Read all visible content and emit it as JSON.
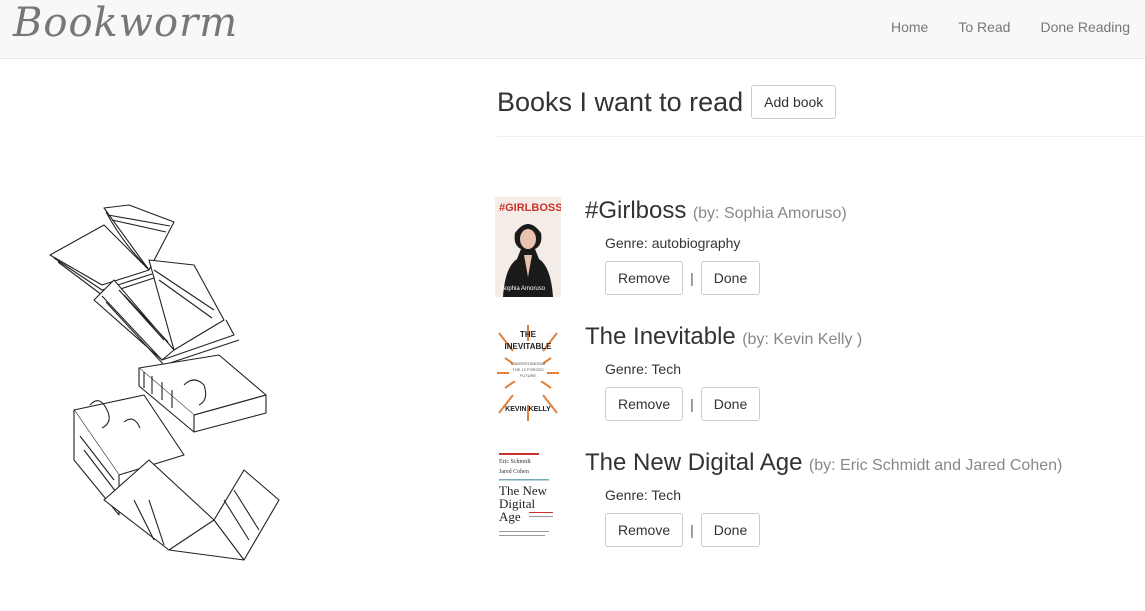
{
  "brand": "Bookworm",
  "nav": {
    "home": "Home",
    "to_read": "To Read",
    "done_reading": "Done Reading"
  },
  "page": {
    "title": "Books I want to read",
    "add_book_label": "Add book"
  },
  "books": [
    {
      "title": "#Girlboss",
      "author": "(by: Sophia Amoruso)",
      "genre": "Genre: autobiography",
      "remove_label": "Remove",
      "separator": "|",
      "done_label": "Done",
      "cover": {
        "title": "#GIRLBOSS",
        "author": "Sophia Amoruso",
        "bg": "#f3ece7",
        "accent": "#c9322b"
      }
    },
    {
      "title": "The Inevitable",
      "author": "(by: Kevin Kelly )",
      "genre": "Genre: Tech",
      "remove_label": "Remove",
      "separator": "|",
      "done_label": "Done",
      "cover": {
        "title_top": "THE",
        "title_bottom": "INEVITABLE",
        "author": "KEVIN KELLY",
        "bg": "#ffffff",
        "accent": "#e0803a"
      }
    },
    {
      "title": "The New Digital Age",
      "author": "(by: Eric Schmidt and Jared Cohen)",
      "genre": "Genre: Tech",
      "remove_label": "Remove",
      "separator": "|",
      "done_label": "Done",
      "cover": {
        "author1": "Eric Schmidt",
        "author2": "Jared Cohen",
        "title_line1": "The New",
        "title_line2": "Digital",
        "title_line3": "Age",
        "bg": "#ffffff",
        "accent": "#333333"
      }
    }
  ]
}
